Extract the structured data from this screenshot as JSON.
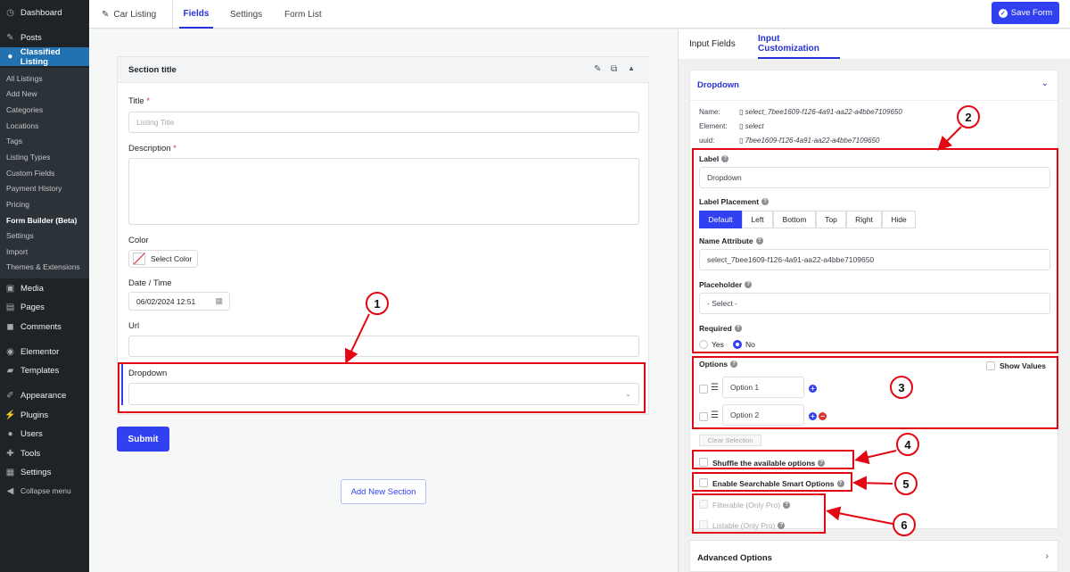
{
  "sidebar": {
    "items": [
      {
        "label": "Dashboard",
        "icon": "dashboard-icon"
      },
      {
        "label": "Posts",
        "icon": "pin-icon"
      },
      {
        "label": "Classified Listing",
        "icon": "location-icon"
      },
      {
        "label": "Media",
        "icon": "media-icon"
      },
      {
        "label": "Pages",
        "icon": "page-icon"
      },
      {
        "label": "Comments",
        "icon": "comment-icon"
      },
      {
        "label": "Elementor",
        "icon": "elementor-icon"
      },
      {
        "label": "Templates",
        "icon": "folder-icon"
      },
      {
        "label": "Appearance",
        "icon": "brush-icon"
      },
      {
        "label": "Plugins",
        "icon": "plug-icon"
      },
      {
        "label": "Users",
        "icon": "user-icon"
      },
      {
        "label": "Tools",
        "icon": "wrench-icon"
      },
      {
        "label": "Settings",
        "icon": "settings-icon"
      },
      {
        "label": "Collapse menu",
        "icon": "collapse-icon"
      }
    ],
    "submenu": [
      "All Listings",
      "Add New",
      "Categories",
      "Locations",
      "Tags",
      "Listing Types",
      "Custom Fields",
      "Payment History",
      "Pricing",
      "Form Builder (Beta)",
      "Settings",
      "Import",
      "Themes & Extensions"
    ]
  },
  "topbar": {
    "form_name": "Car Listing",
    "tabs": [
      "Fields",
      "Settings",
      "Form List"
    ],
    "save_label": "Save Form"
  },
  "builder": {
    "section_title": "Section title",
    "title_label": "Title",
    "title_placeholder": "Listing Title",
    "description_label": "Description",
    "required_mark": "*",
    "color_label": "Color",
    "select_color": "Select Color",
    "datetime_label": "Date / Time",
    "datetime_value": "06/02/2024 12:51",
    "url_label": "Url",
    "dropdown_label": "Dropdown",
    "submit_label": "Submit",
    "add_section_label": "Add New Section"
  },
  "panel": {
    "tabs": [
      "Input Fields",
      "Input Customization"
    ],
    "card_title": "Dropdown",
    "meta": {
      "name_key": "Name:",
      "name_val": "select_7bee1609-f126-4a91-aa22-a4bbe7109650",
      "element_key": "Element:",
      "element_val": "select",
      "uuid_key": "uuid:",
      "uuid_val": "7bee1609-f126-4a91-aa22-a4bbe7109650"
    },
    "label_title": "Label",
    "label_value": "Dropdown",
    "placement_title": "Label Placement",
    "placements": [
      "Default",
      "Left",
      "Bottom",
      "Top",
      "Right",
      "Hide"
    ],
    "name_attr_title": "Name Attribute",
    "name_attr_value": "select_7bee1609-f126-4a91-aa22-a4bbe7109650",
    "placeholder_title": "Placeholder",
    "placeholder_value": "- Select -",
    "required_title": "Required",
    "required_yes": "Yes",
    "required_no": "No",
    "options_title": "Options",
    "show_values": "Show Values",
    "options": [
      "Option 1",
      "Option 2"
    ],
    "clear_selection": "Clear Selection",
    "shuffle": "Shuffle the available options",
    "searchable": "Enable Searchable Smart Options",
    "filterable": "Filterable (Only Pro)",
    "listable": "Listable (Only Pro)",
    "advanced": "Advanced Options"
  },
  "annotations": [
    "1",
    "2",
    "3",
    "4",
    "5",
    "6"
  ],
  "colors": {
    "accent": "#3140f0",
    "annotation": "#e30613",
    "sidebar": "#1d2327",
    "active_menu": "#2271b1"
  }
}
